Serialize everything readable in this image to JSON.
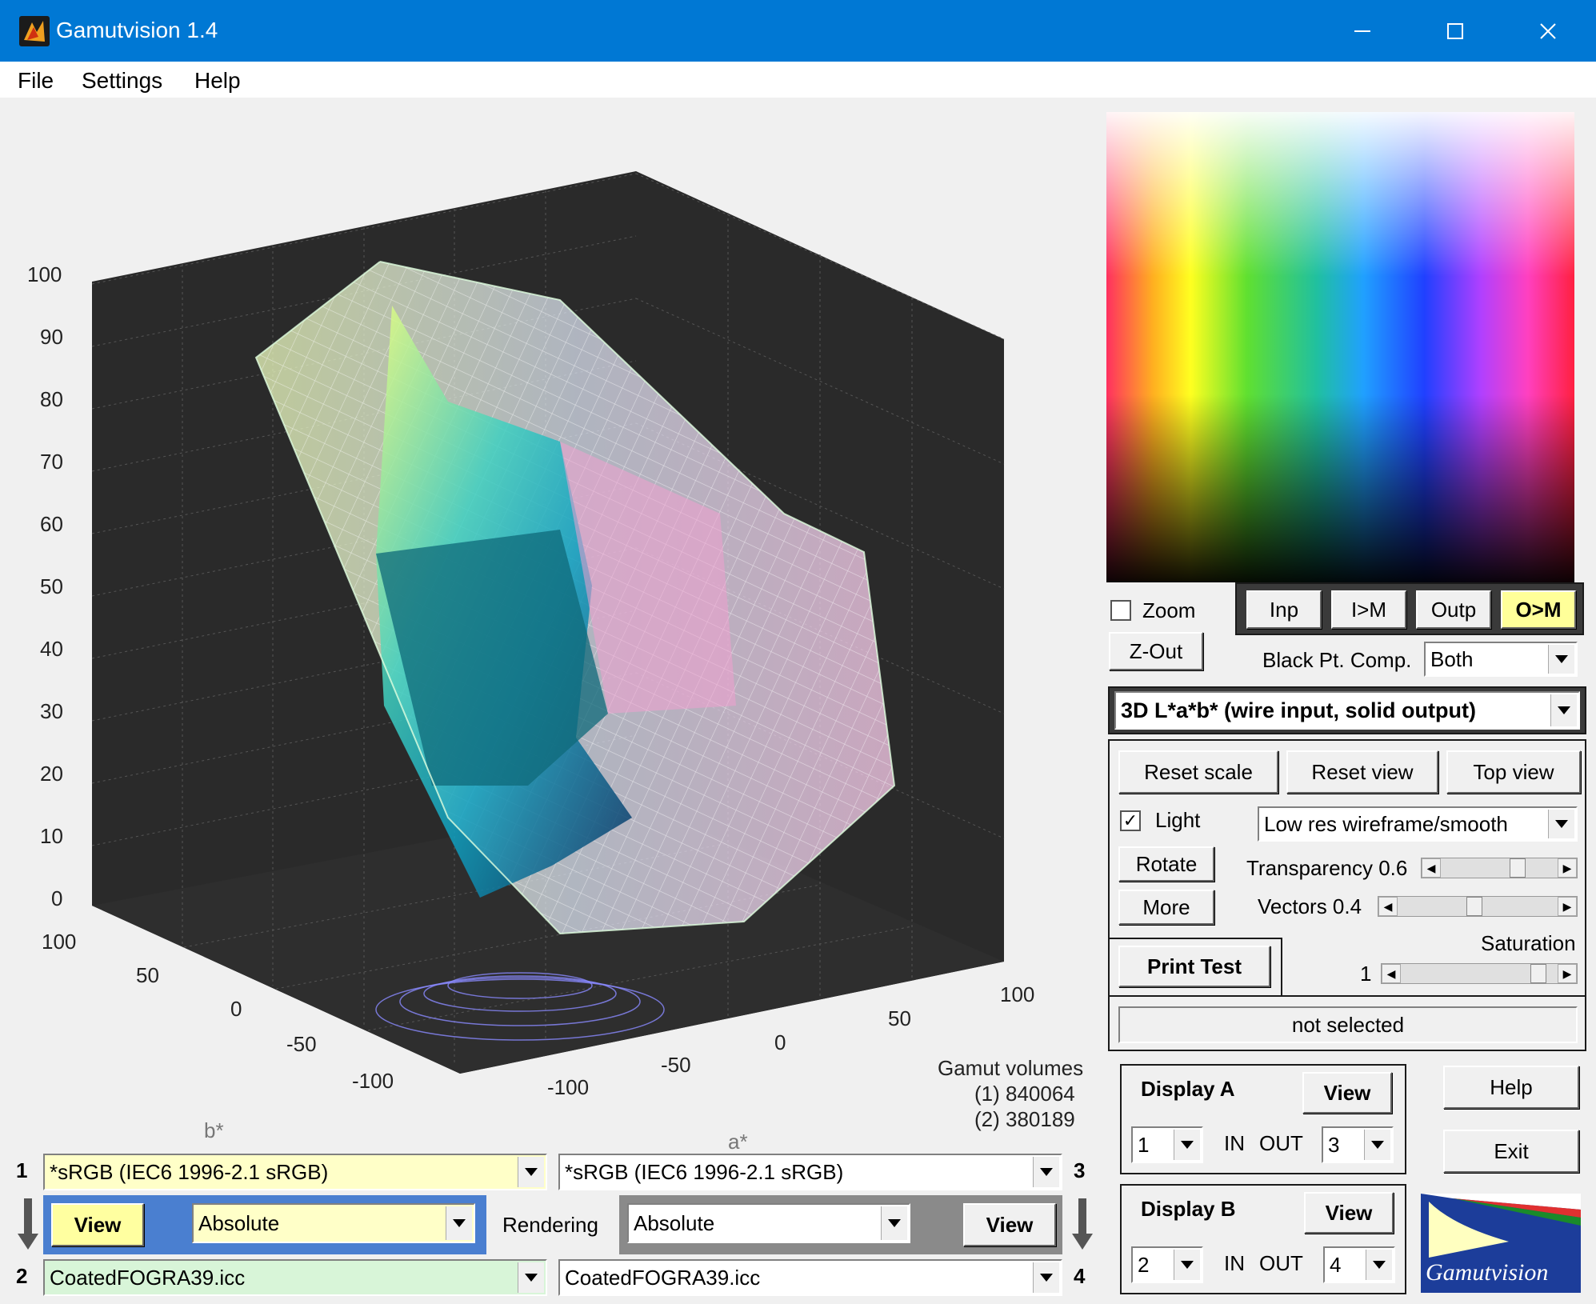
{
  "window": {
    "title": "Gamutvision 1.4"
  },
  "menu": {
    "file": "File",
    "settings": "Settings",
    "help": "Help"
  },
  "plot": {
    "z_ticks": [
      "100",
      "90",
      "80",
      "70",
      "60",
      "50",
      "40",
      "30",
      "20",
      "10",
      "0"
    ],
    "b_ticks": [
      "100",
      "50",
      "0",
      "-50",
      "-100"
    ],
    "a_ticks": [
      "-100",
      "-50",
      "0",
      "50",
      "100"
    ],
    "b_label": "b*",
    "a_label": "a*",
    "volumes_title": "Gamut volumes",
    "volume1": "(1)  840064",
    "volume2": "(2)  380189"
  },
  "view_buttons": {
    "inp": "Inp",
    "im": "I>M",
    "outp": "Outp",
    "om": "O>M"
  },
  "zoom": {
    "label": "Zoom",
    "checked": false,
    "zout": "Z-Out"
  },
  "bpc": {
    "label": "Black Pt. Comp.",
    "value": "Both"
  },
  "plot_mode": {
    "value": "3D L*a*b* (wire input, solid output)"
  },
  "controls": {
    "reset_scale": "Reset scale",
    "reset_view": "Reset view",
    "top_view": "Top view",
    "light": "Light",
    "light_checked": true,
    "render_mode": "Low res wireframe/smooth",
    "rotate": "Rotate",
    "more": "More",
    "transparency_label": "Transparency 0.6",
    "transparency_value": 0.6,
    "vectors_label": "Vectors 0.4",
    "vectors_value": 0.4,
    "saturation_label": "Saturation",
    "saturation_value": "1",
    "print_test": "Print Test",
    "status": "not selected"
  },
  "display_a": {
    "title": "Display A",
    "view": "View",
    "in": "1",
    "in_label": "IN",
    "out_label": "OUT",
    "out": "3"
  },
  "display_b": {
    "title": "Display B",
    "view": "View",
    "in": "2",
    "in_label": "IN",
    "out_label": "OUT",
    "out": "4"
  },
  "side_buttons": {
    "help": "Help",
    "exit": "Exit"
  },
  "logo": {
    "text": "Gamutvision"
  },
  "profiles": {
    "p1_num": "1",
    "p1": "*sRGB   (IEC6 1996-2.1 sRGB)",
    "p3_num": "3",
    "p3": "*sRGB   (IEC6 1996-2.1 sRGB)",
    "p2_num": "2",
    "p2": "CoatedFOGRA39.icc",
    "p4_num": "4",
    "p4": "CoatedFOGRA39.icc"
  },
  "rendering": {
    "left_view": "View",
    "left_intent": "Absolute",
    "label": "Rendering",
    "right_intent": "Absolute",
    "right_view": "View"
  },
  "colors": {
    "titlebar": "#0078d4",
    "active_om": "#ffff99",
    "profile1_bg": "#ffffc8",
    "profile2_bg": "#d8f5d8",
    "blue_band": "#4a7fd0",
    "gray_band": "#8a8a8a"
  }
}
